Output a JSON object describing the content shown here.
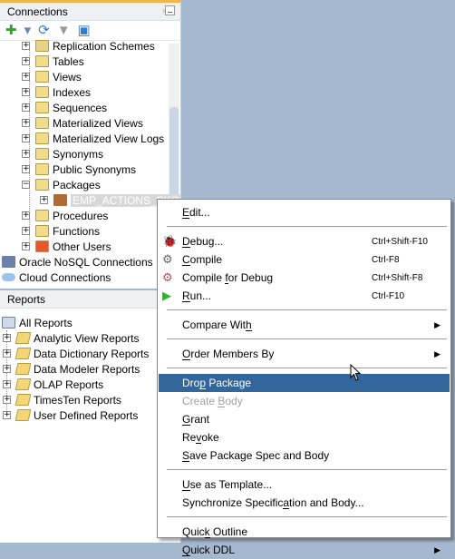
{
  "connections_panel": {
    "title": "Connections",
    "close": "×",
    "toolbar": [
      {
        "icon": "add-icon",
        "glyph": "✚",
        "color": "#22aa22"
      },
      {
        "icon": "dropdown-arrow-icon",
        "glyph": "▾",
        "color": "#6a84a8"
      },
      {
        "icon": "refresh-icon",
        "glyph": "⟳",
        "color": "#2a7fd4"
      },
      {
        "icon": "filter-icon",
        "glyph": "▼",
        "color": "#999999"
      },
      {
        "icon": "collapse-all-icon",
        "glyph": "▣",
        "color": "#2a7fd4"
      }
    ],
    "tree": [
      {
        "label": "Replication Schemes",
        "expander": "+"
      },
      {
        "label": "Tables",
        "expander": "+"
      },
      {
        "label": "Views",
        "expander": "+"
      },
      {
        "label": "Indexes",
        "expander": "+"
      },
      {
        "label": "Sequences",
        "expander": "+"
      },
      {
        "label": "Materialized Views",
        "expander": "+"
      },
      {
        "label": "Materialized View Logs",
        "expander": "+"
      },
      {
        "label": "Synonyms",
        "expander": "+"
      },
      {
        "label": "Public Synonyms",
        "expander": "+"
      },
      {
        "label": "Packages",
        "expander": "−"
      },
      {
        "label": "EMP_ACTIONS_PKG",
        "expander": "+",
        "selected": true
      },
      {
        "label": "Procedures",
        "expander": "+"
      },
      {
        "label": "Functions",
        "expander": "+"
      },
      {
        "label": "Other Users",
        "expander": "+"
      },
      {
        "label": "Oracle NoSQL Connections"
      },
      {
        "label": "Cloud Connections"
      }
    ]
  },
  "reports_panel": {
    "title": "Reports",
    "close": "×",
    "root": "All Reports",
    "items": [
      "Analytic View Reports",
      "Data Dictionary Reports",
      "Data Modeler Reports",
      "OLAP Reports",
      "TimesTen Reports",
      "User Defined Reports"
    ]
  },
  "context_menu": {
    "items": [
      {
        "label": "Edit...",
        "mn": 0
      },
      {
        "sep": true
      },
      {
        "label": "Debug...",
        "mn": 0,
        "shortcut": "Ctrl+Shift-F10",
        "icon": "bug-icon"
      },
      {
        "label": "Compile",
        "mn": 0,
        "shortcut": "Ctrl-F8",
        "icon": "gears-icon"
      },
      {
        "label": "Compile for Debug",
        "mn": 8,
        "shortcut": "Ctrl+Shift-F8",
        "icon": "gears-bug-icon"
      },
      {
        "label": "Run...",
        "mn": 0,
        "shortcut": "Ctrl-F10",
        "icon": "run-icon"
      },
      {
        "sep": true
      },
      {
        "label": "Compare With",
        "mn": 11,
        "submenu": true
      },
      {
        "sep": true
      },
      {
        "label": "Order Members By",
        "mn": 0,
        "submenu": true
      },
      {
        "sep": true
      },
      {
        "label": "Drop Package",
        "mn": 3,
        "highlighted": true
      },
      {
        "label": "Create Body",
        "mn": 7,
        "disabled": true
      },
      {
        "label": "Grant",
        "mn": 0
      },
      {
        "label": "Revoke",
        "mn": 2
      },
      {
        "label": "Save Package Spec and Body",
        "mn": 0
      },
      {
        "sep": true
      },
      {
        "label": "Use as Template...",
        "mn": 0
      },
      {
        "label": "Synchronize Specification and Body...",
        "mn": 20
      },
      {
        "sep": true
      },
      {
        "label": "Quick Outline",
        "mn": 4
      },
      {
        "label": "Quick DDL",
        "mn": 0,
        "submenu": true
      }
    ]
  },
  "colors": {
    "highlight": "#33669a",
    "desktop": "#a4b8cf",
    "tab_accent": "#f2b54a"
  }
}
